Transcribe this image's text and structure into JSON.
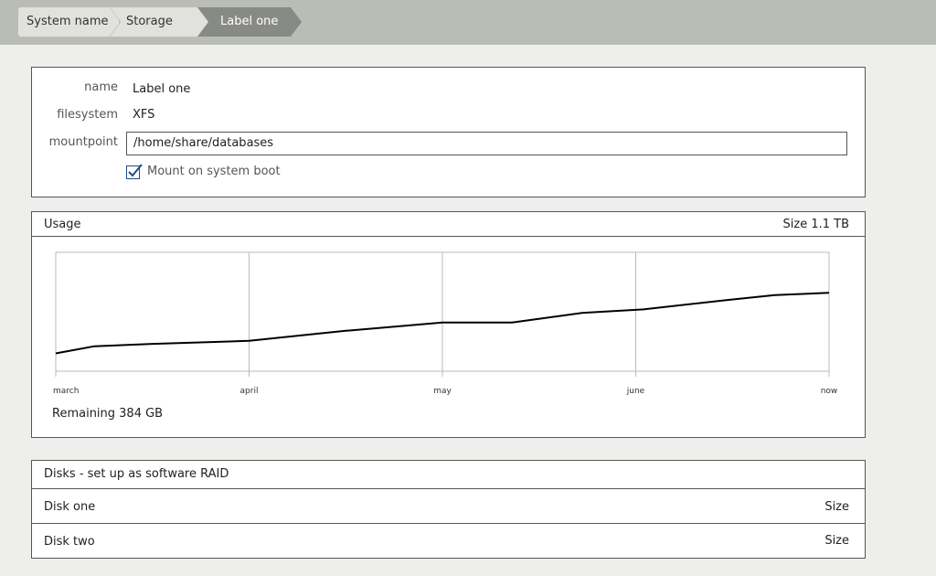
{
  "breadcrumb": {
    "items": [
      "System name",
      "Storage",
      "Label one"
    ]
  },
  "properties": {
    "name_label": "name",
    "name_value": "Label one",
    "filesystem_label": "filesystem",
    "filesystem_value": "XFS",
    "mountpoint_label": "mountpoint",
    "mountpoint_value": "/home/share/databases",
    "mount_on_boot_label": "Mount on system boot",
    "mount_on_boot_checked": true
  },
  "usage": {
    "title": "Usage",
    "size": "Size 1.1 TB",
    "remaining": "Remaining 384 GB"
  },
  "chart_data": {
    "type": "line",
    "x_labels": [
      "march",
      "april",
      "may",
      "june",
      "now"
    ],
    "x": [
      0,
      0.05,
      0.125,
      0.25,
      0.375,
      0.5,
      0.59,
      0.68,
      0.76,
      0.87,
      0.93,
      1.0
    ],
    "values": [
      0.15,
      0.21,
      0.23,
      0.255,
      0.34,
      0.41,
      0.41,
      0.49,
      0.52,
      0.6,
      0.64,
      0.66
    ],
    "ylim": [
      0,
      1
    ],
    "grid": true,
    "title": "",
    "xlabel": "",
    "ylabel": "",
    "line_color": "#000000",
    "grid_color": "#babdb6"
  },
  "disks": {
    "header": "Disks - set up as software RAID",
    "rows": [
      {
        "label": "Disk one",
        "size": "Size"
      },
      {
        "label": "Disk two",
        "size": "Size"
      }
    ]
  },
  "colors": {
    "header_bg": "#babdb6",
    "crumb_bg": "#e1e2de",
    "crumb_active_bg": "#888a85",
    "page_bg": "#eeeeec",
    "checkbox_accent": "#204a87"
  }
}
